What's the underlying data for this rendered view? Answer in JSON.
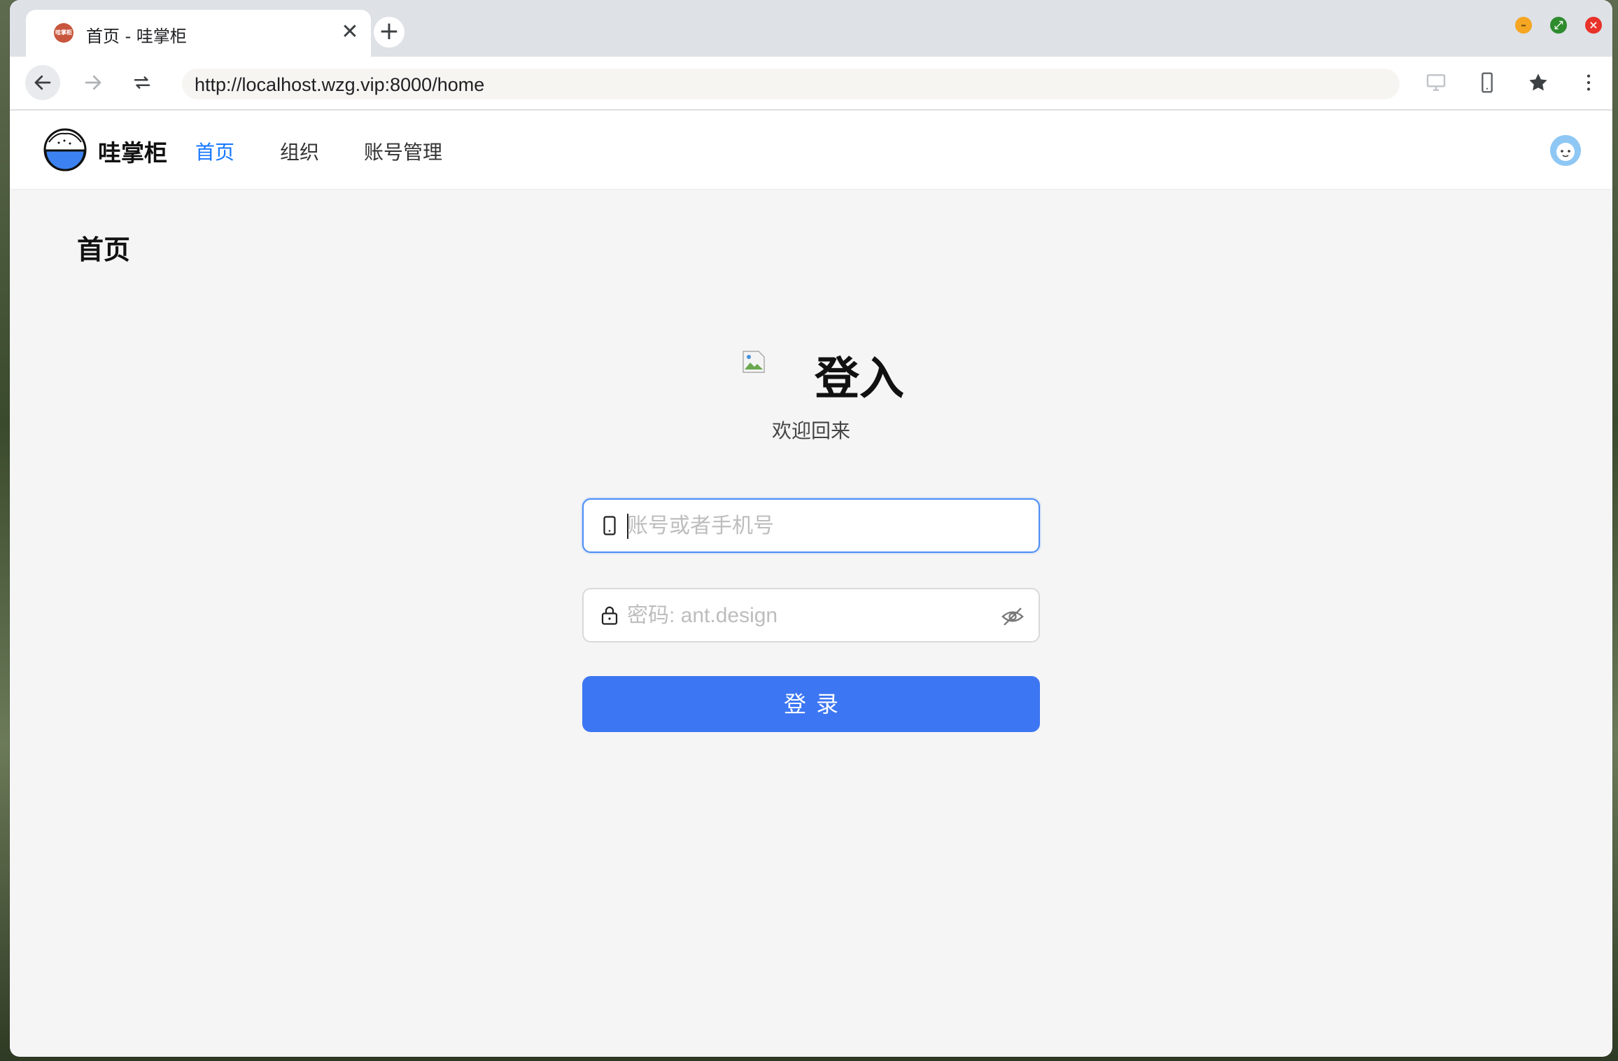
{
  "browser": {
    "tab_title": "首页 - 哇掌柜",
    "tab_favicon_text": "哇掌柜",
    "url": "http://localhost.wzg.vip:8000/home"
  },
  "app": {
    "brand": "哇掌柜",
    "nav": [
      {
        "label": "首页",
        "active": true
      },
      {
        "label": "组织",
        "active": false
      },
      {
        "label": "账号管理",
        "active": false
      }
    ]
  },
  "page": {
    "title": "首页"
  },
  "login": {
    "title": "登入",
    "subtitle": "欢迎回来",
    "account_placeholder": "账号或者手机号",
    "password_placeholder": "密码: ant.design",
    "submit_label": "登录"
  },
  "colors": {
    "primary": "#3c76f2",
    "nav_active": "#1677ff",
    "focus_border": "#4b8cf5"
  },
  "icons": {
    "back": "arrow-left-icon",
    "forward": "arrow-right-icon",
    "reload": "reload-icon",
    "desktop": "desktop-icon",
    "mobile": "mobile-icon",
    "bookmark": "star-icon",
    "menu": "more-vert-icon",
    "account_field": "mobile-icon",
    "password_field": "lock-icon",
    "toggle_visibility": "eye-invisible-icon"
  }
}
